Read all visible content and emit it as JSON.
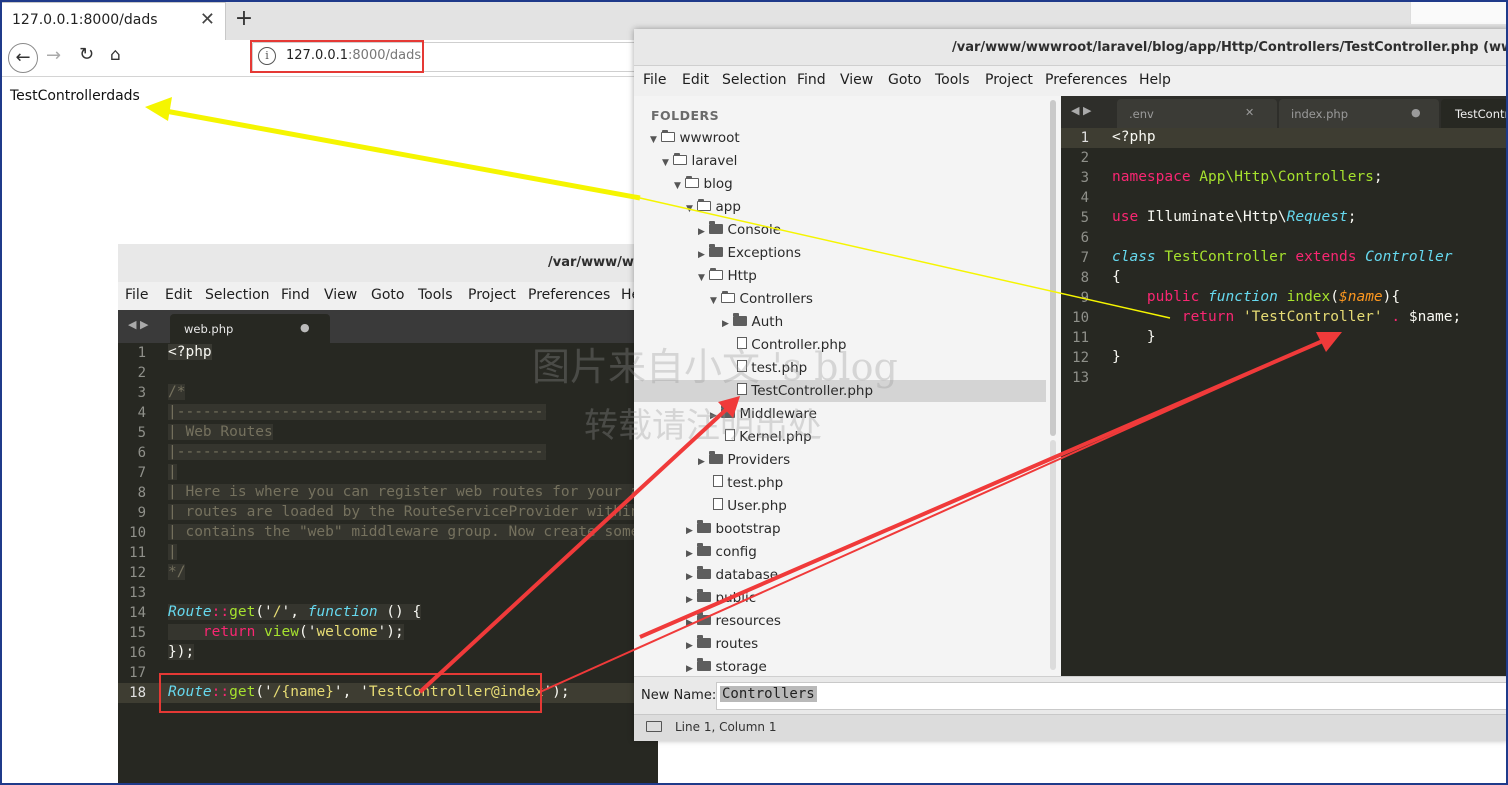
{
  "browser": {
    "tab_title": "127.0.0.1:8000/dads",
    "tab_close": "✕",
    "new_tab": "+",
    "url_host": "127.0.0.1",
    "url_rest": ":8000/dads",
    "page_output": "TestControllerdads",
    "buttons": {
      "back": "←",
      "forward": "→",
      "reload": "↻",
      "home": "⌂"
    }
  },
  "left_editor": {
    "title": "/var/www/w",
    "menu": [
      "File",
      "Edit",
      "Selection",
      "Find",
      "View",
      "Goto",
      "Tools",
      "Project",
      "Preferences",
      "He"
    ],
    "tab": "web.php",
    "tab_dot": "●",
    "line_numbers": [
      "1",
      "2",
      "3",
      "4",
      "5",
      "6",
      "7",
      "8",
      "9",
      "10",
      "11",
      "12",
      "13",
      "14",
      "15",
      "16",
      "17",
      "18"
    ],
    "code": {
      "l1": "<?php",
      "l3": "/*",
      "l4": "|--------------------------------------------------------------------------",
      "l5": "| Web Routes",
      "l6": "|--------------------------------------------------------------------------",
      "l7": "|",
      "l8": "| Here is where you can register web routes for your ap",
      "l9": "| routes are loaded by the RouteServiceProvider within",
      "l10": "| contains the \"web\" middleware group. Now create some",
      "l11": "|",
      "l12": "*/",
      "l14_a": "Route",
      "l14_b": "::",
      "l14_c": "get",
      "l14_d": "('",
      "l14_e": "/",
      "l14_f": "', ",
      "l14_g": "function",
      "l14_h": " () {",
      "l15_a": "    ",
      "l15_b": "return",
      "l15_c": " view",
      "l15_d": "('",
      "l15_e": "welcome",
      "l15_f": "');",
      "l16": "});",
      "l18_a": "Route",
      "l18_b": "::",
      "l18_c": "get",
      "l18_d": "('",
      "l18_e": "/{name}",
      "l18_f": "', '",
      "l18_g": "TestController@index",
      "l18_h": "');"
    }
  },
  "right_editor": {
    "title": "/var/www/wwwroot/laravel/blog/app/Http/Controllers/TestController.php (wwwro",
    "menu": [
      "File",
      "Edit",
      "Selection",
      "Find",
      "View",
      "Goto",
      "Tools",
      "Project",
      "Preferences",
      "Help"
    ],
    "folders_label": "FOLDERS",
    "tree": {
      "wwwroot": "wwwroot",
      "laravel": "laravel",
      "blog": "blog",
      "app": "app",
      "console": "Console",
      "exceptions": "Exceptions",
      "http": "Http",
      "controllers": "Controllers",
      "auth": "Auth",
      "controller_php": "Controller.php",
      "test_php": "test.php",
      "testcontroller_php": "TestController.php",
      "middleware": "Middleware",
      "kernel_php": "Kernel.php",
      "providers": "Providers",
      "app_test_php": "test.php",
      "user_php": "User.php",
      "bootstrap": "bootstrap",
      "config": "config",
      "database": "database",
      "public": "public",
      "resources": "resources",
      "routes": "routes",
      "storage": "storage"
    },
    "tabs": [
      ".env",
      "index.php",
      "TestContr"
    ],
    "tab_close": "✕",
    "tab_dot": "●",
    "line_numbers": [
      "1",
      "2",
      "3",
      "4",
      "5",
      "6",
      "7",
      "8",
      "9",
      "10",
      "11",
      "12",
      "13"
    ],
    "code": {
      "l1": "<?php",
      "l3_a": "namespace",
      "l3_b": " App\\Http\\Controllers",
      "l3_c": ";",
      "l5_a": "use",
      "l5_b": " Illuminate\\Http\\",
      "l5_c": "Request",
      "l5_d": ";",
      "l7_a": "class",
      "l7_b": " TestController ",
      "l7_c": "extends",
      "l7_d": " Controller",
      "l8": "{",
      "l9_a": "    public ",
      "l9_b": "function",
      "l9_c": " index",
      "l9_d": "(",
      "l9_e": "$name",
      "l9_f": "){",
      "l10_a": "        return ",
      "l10_b": "'TestController'",
      "l10_c": " . ",
      "l10_d": "$name;",
      "l11": "    }",
      "l12": "}"
    },
    "new_name_label": "New Name:",
    "new_name_value": "Controllers",
    "status": "Line 1, Column 1"
  },
  "watermark": {
    "line1": "图片来自小文 's blog",
    "line2": "转载请注明出处"
  },
  "colors": {
    "highlight_box": "#e53935",
    "arrow_yellow": "#f5f500",
    "arrow_red": "#f03a3a",
    "editor_bg": "#272822"
  }
}
